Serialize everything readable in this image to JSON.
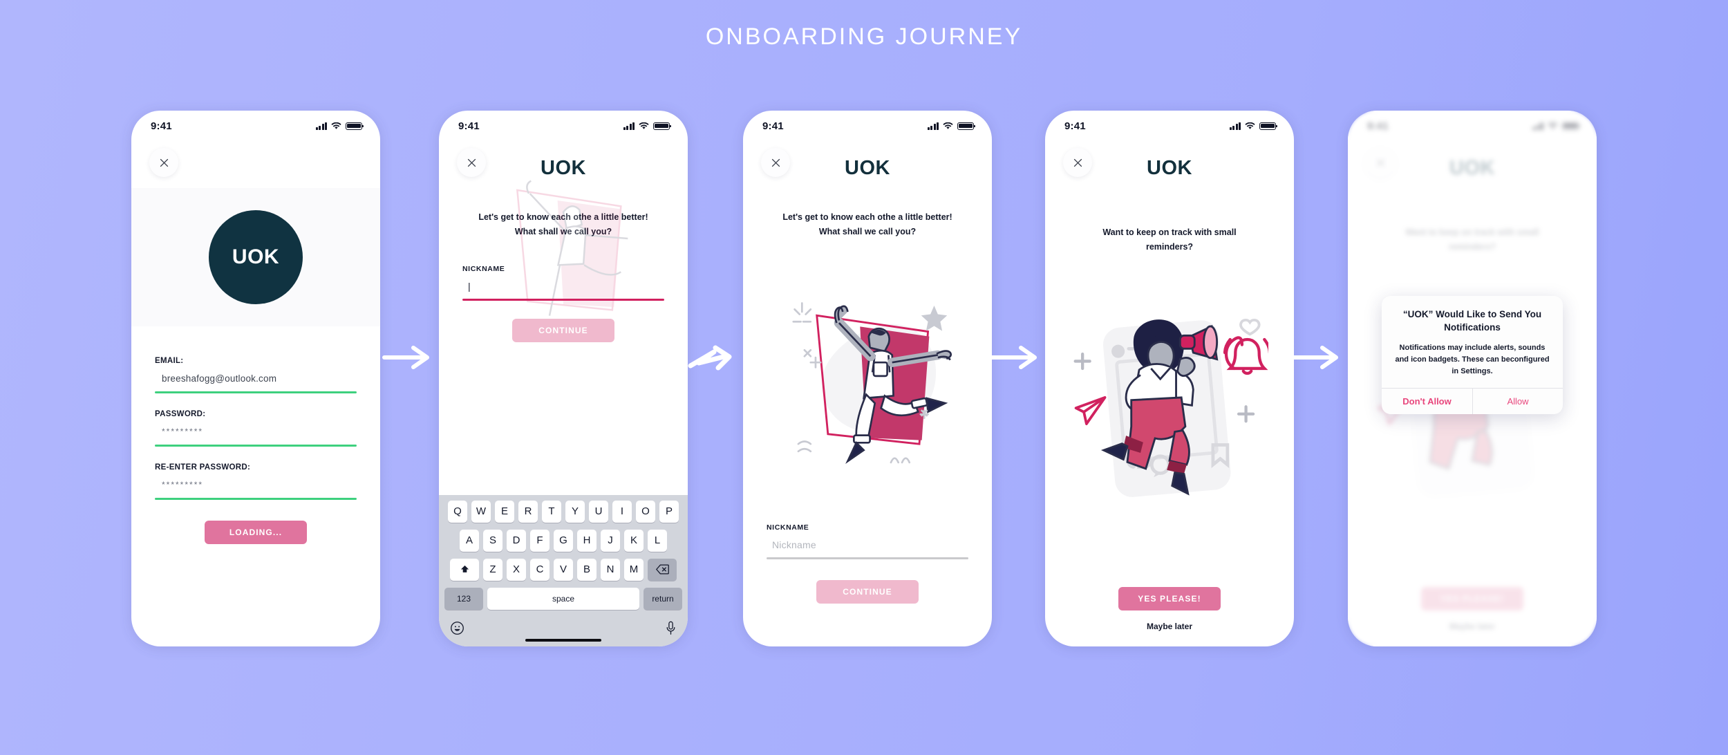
{
  "page": {
    "title": "ONBOARDING JOURNEY",
    "background_color": "#aab1fd",
    "accent_pink": "#e0749e",
    "accent_magenta": "#d1215f",
    "brand_dark": "#103341",
    "success_green": "#3ed07e"
  },
  "status_bar": {
    "time": "9:41"
  },
  "brand": {
    "wordmark": "UOK",
    "logo_text": "UOK"
  },
  "screens": [
    {
      "id": "signup",
      "form": {
        "fields": [
          {
            "label": "EMAIL:",
            "value": "breeshafogg@outlook.com",
            "masked": false
          },
          {
            "label": "PASSWORD:",
            "value": "*********",
            "masked": true
          },
          {
            "label": "RE-ENTER PASSWORD:",
            "value": "*********",
            "masked": true
          }
        ],
        "submit_label": "LOADING..."
      }
    },
    {
      "id": "nickname-typing",
      "prompt": "Let's get to know each othe a little better! What shall we call you?",
      "nickname": {
        "label": "NICKNAME",
        "value": "|",
        "placeholder": "Nickname"
      },
      "continue_label": "CONTINUE",
      "keyboard": {
        "row1": [
          "Q",
          "W",
          "E",
          "R",
          "T",
          "Y",
          "U",
          "I",
          "O",
          "P"
        ],
        "row2": [
          "A",
          "S",
          "D",
          "F",
          "G",
          "H",
          "J",
          "K",
          "L"
        ],
        "row3": [
          "Z",
          "X",
          "C",
          "V",
          "B",
          "N",
          "M"
        ],
        "shift_key": "shift-key",
        "backspace_key": "backspace-key",
        "numbers_label": "123",
        "space_label": "space",
        "return_label": "return",
        "emoji_key": "emoji-key",
        "mic_key": "microphone-key"
      }
    },
    {
      "id": "nickname-empty",
      "prompt": "Let's get to know each othe a little better! What shall we call you?",
      "nickname": {
        "label": "NICKNAME",
        "value": "Nickname",
        "placeholder": "Nickname"
      },
      "continue_label": "CONTINUE"
    },
    {
      "id": "notifications-ask",
      "prompt": "Want to keep on track with small reminders?",
      "primary_label": "YES PLEASE!",
      "secondary_label": "Maybe later"
    },
    {
      "id": "notifications-permission",
      "prompt": "Want to keep on track with small reminders?",
      "primary_label": "YES PLEASE!",
      "secondary_label": "Maybe later",
      "dialog": {
        "title": "“UOK” Would Like to Send You Notifications",
        "message": "Notifications may include alerts, sounds and icon badgets. These can beconfigured in Settings.",
        "deny_label": "Don't Allow",
        "allow_label": "Allow"
      }
    }
  ],
  "arrows": [
    {
      "name": "arrow-1",
      "style": "straight"
    },
    {
      "name": "arrow-2",
      "style": "zigzag"
    },
    {
      "name": "arrow-3",
      "style": "straight"
    },
    {
      "name": "arrow-4",
      "style": "straight"
    }
  ]
}
